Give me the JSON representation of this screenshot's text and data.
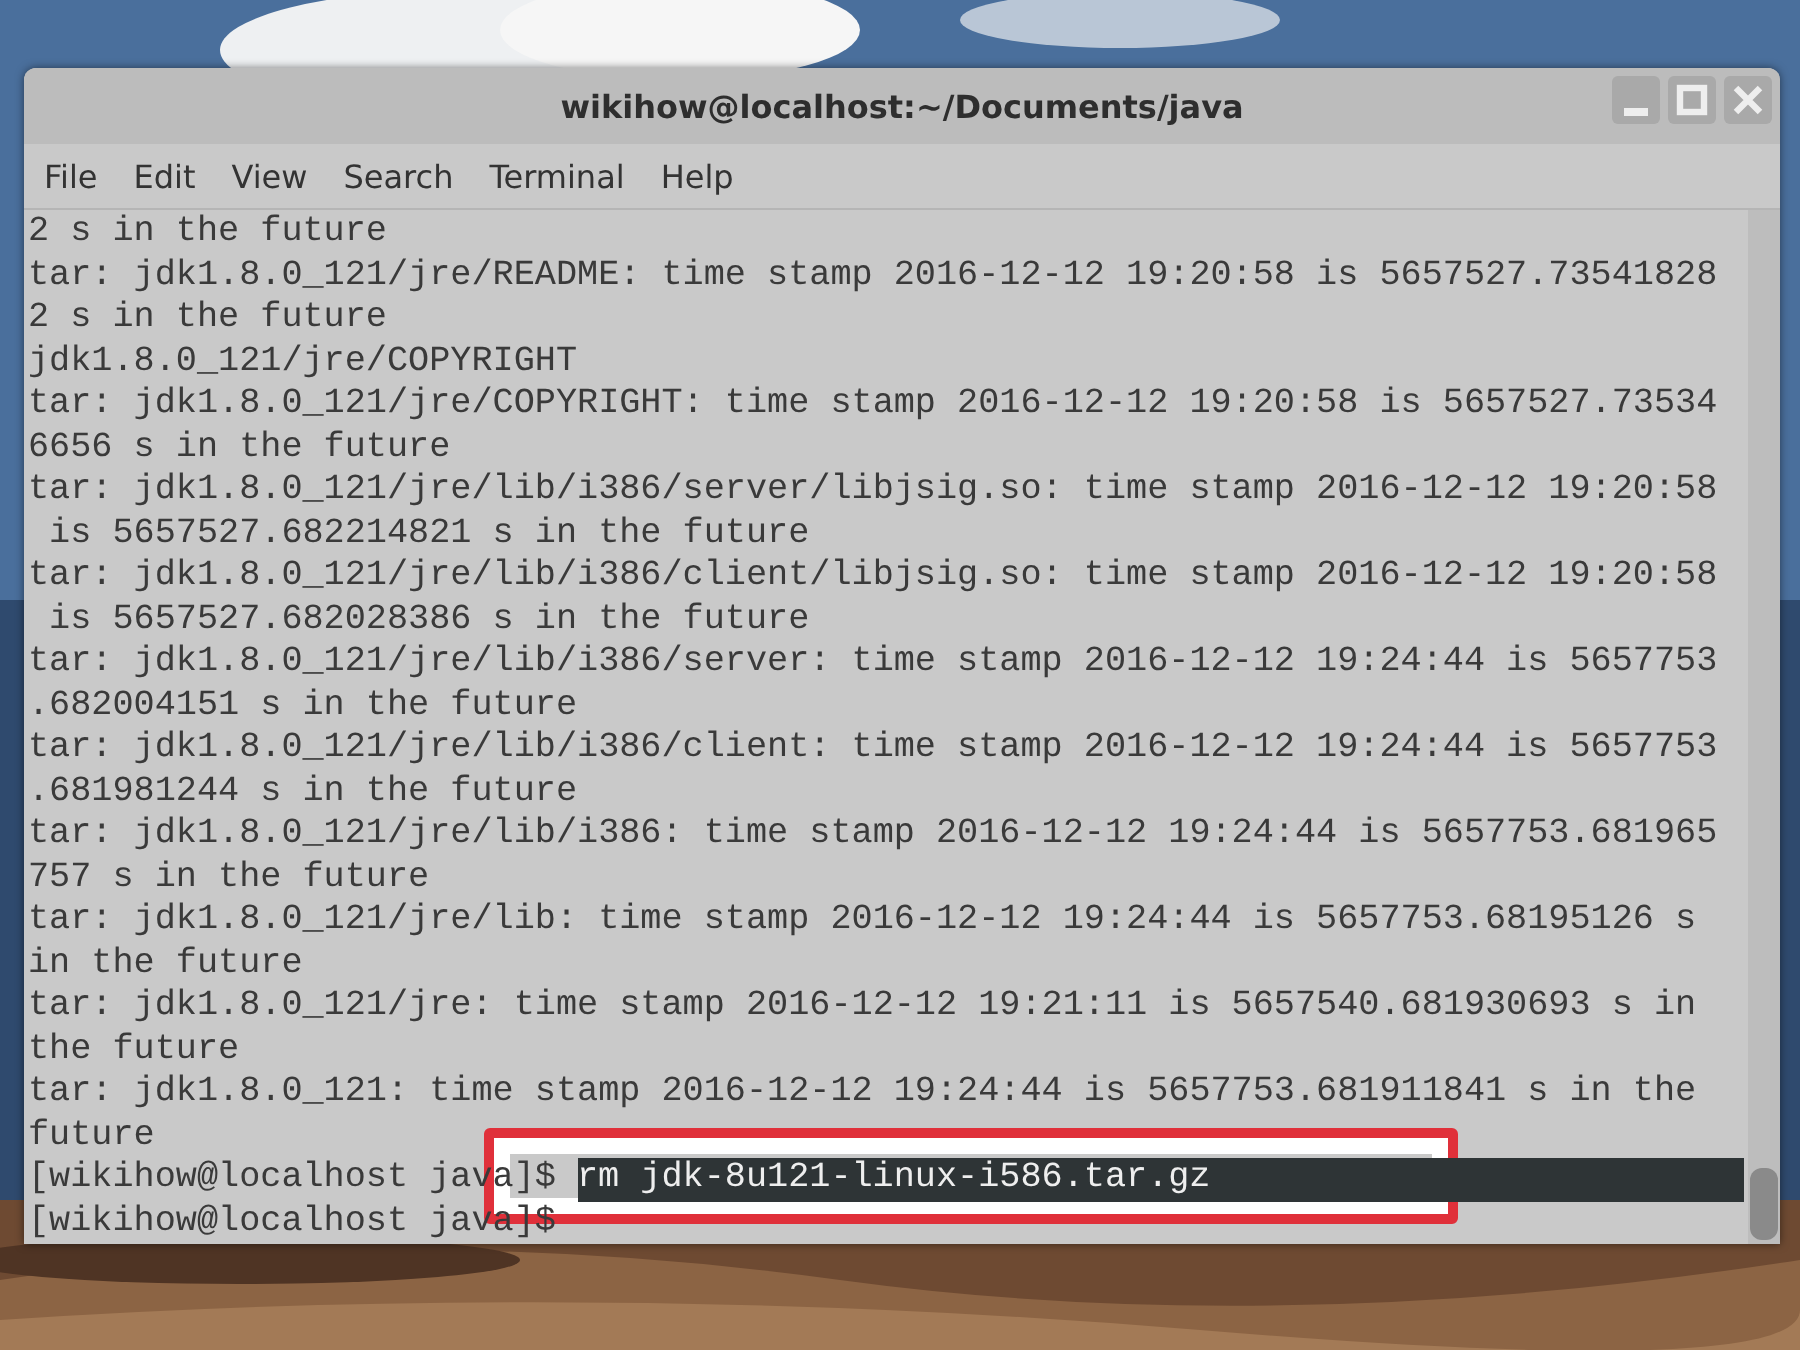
{
  "window": {
    "title": "wikihow@localhost:~/Documents/java"
  },
  "menu": [
    "File",
    "Edit",
    "View",
    "Search",
    "Terminal",
    "Help"
  ],
  "terminal": {
    "lines": [
      {
        "kind": "output",
        "text": "2 s in the future"
      },
      {
        "kind": "output",
        "text": "tar: jdk1.8.0_121/jre/README: time stamp 2016-12-12 19:20:58 is 5657527.73541828"
      },
      {
        "kind": "output",
        "text": "2 s in the future"
      },
      {
        "kind": "output",
        "text": "jdk1.8.0_121/jre/COPYRIGHT"
      },
      {
        "kind": "output",
        "text": "tar: jdk1.8.0_121/jre/COPYRIGHT: time stamp 2016-12-12 19:20:58 is 5657527.73534"
      },
      {
        "kind": "output",
        "text": "6656 s in the future"
      },
      {
        "kind": "output",
        "text": "tar: jdk1.8.0_121/jre/lib/i386/server/libjsig.so: time stamp 2016-12-12 19:20:58"
      },
      {
        "kind": "output",
        "text": " is 5657527.682214821 s in the future"
      },
      {
        "kind": "output",
        "text": "tar: jdk1.8.0_121/jre/lib/i386/client/libjsig.so: time stamp 2016-12-12 19:20:58"
      },
      {
        "kind": "output",
        "text": " is 5657527.682028386 s in the future"
      },
      {
        "kind": "output",
        "text": "tar: jdk1.8.0_121/jre/lib/i386/server: time stamp 2016-12-12 19:24:44 is 5657753"
      },
      {
        "kind": "output",
        "text": ".682004151 s in the future"
      },
      {
        "kind": "output",
        "text": "tar: jdk1.8.0_121/jre/lib/i386/client: time stamp 2016-12-12 19:24:44 is 5657753"
      },
      {
        "kind": "output",
        "text": ".681981244 s in the future"
      },
      {
        "kind": "output",
        "text": "tar: jdk1.8.0_121/jre/lib/i386: time stamp 2016-12-12 19:24:44 is 5657753.681965"
      },
      {
        "kind": "output",
        "text": "757 s in the future"
      },
      {
        "kind": "output",
        "text": "tar: jdk1.8.0_121/jre/lib: time stamp 2016-12-12 19:24:44 is 5657753.68195126 s"
      },
      {
        "kind": "output",
        "text": "in the future"
      },
      {
        "kind": "output",
        "text": "tar: jdk1.8.0_121/jre: time stamp 2016-12-12 19:21:11 is 5657540.681930693 s in"
      },
      {
        "kind": "output",
        "text": "the future"
      },
      {
        "kind": "output",
        "text": "tar: jdk1.8.0_121: time stamp 2016-12-12 19:24:44 is 5657753.681911841 s in the"
      },
      {
        "kind": "output",
        "text": "future"
      },
      {
        "kind": "prompt",
        "prompt": "[wikihow@localhost java]$",
        "command": "rm jdk-8u121-linux-i586.tar.gz",
        "selected": true,
        "highlighted": true
      },
      {
        "kind": "prompt",
        "prompt": "[wikihow@localhost java]$"
      }
    ]
  }
}
